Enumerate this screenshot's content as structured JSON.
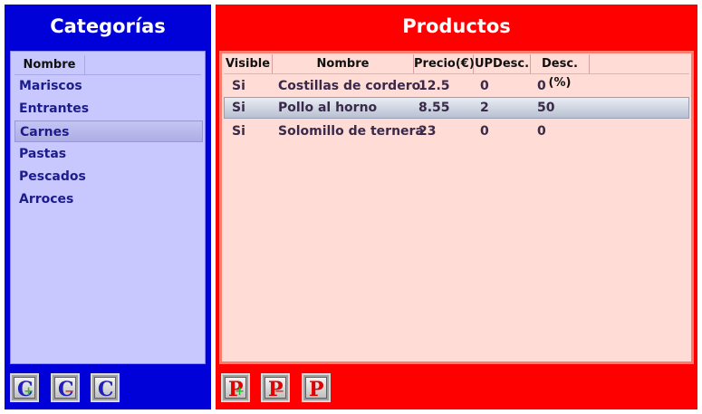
{
  "categorias": {
    "title": "Categorías",
    "column_header": "Nombre",
    "items": [
      {
        "label": "Mariscos"
      },
      {
        "label": "Entrantes"
      },
      {
        "label": "Carnes",
        "selected": true
      },
      {
        "label": "Pastas"
      },
      {
        "label": "Pescados"
      },
      {
        "label": "Arroces"
      }
    ],
    "buttons": [
      {
        "letter": "C",
        "mark": "+",
        "mark_color": "#20c020",
        "action": "add"
      },
      {
        "letter": "C",
        "mark": "−",
        "mark_color": "#e03020",
        "action": "remove"
      },
      {
        "letter": "C",
        "mark": "",
        "mark_color": "#ffffff",
        "action": "edit"
      }
    ]
  },
  "productos": {
    "title": "Productos",
    "columns": [
      "Visible",
      "Nombre",
      "Precio(€)",
      "UPDesc.",
      "Desc.(%)"
    ],
    "rows": [
      {
        "visible": "Si",
        "nombre": "Costillas de cordero",
        "precio": "12.5",
        "updesc": "0",
        "desc": "0"
      },
      {
        "visible": "Si",
        "nombre": "Pollo al horno",
        "precio": "8.55",
        "updesc": "2",
        "desc": "50",
        "selected": true
      },
      {
        "visible": "Si",
        "nombre": "Solomillo de ternera",
        "precio": "23",
        "updesc": "0",
        "desc": "0"
      }
    ],
    "buttons": [
      {
        "letter": "P",
        "mark": "+",
        "mark_color": "#20c020",
        "action": "add"
      },
      {
        "letter": "P",
        "mark": "−",
        "mark_color": "#e03020",
        "action": "remove"
      },
      {
        "letter": "P",
        "mark": "",
        "mark_color": "#ffffff",
        "action": "edit"
      }
    ]
  },
  "colors": {
    "categorias_bg": "#0000d8",
    "productos_bg": "#ff0000",
    "cat_button_letter": "#2020c0",
    "prod_button_letter": "#e00000"
  }
}
